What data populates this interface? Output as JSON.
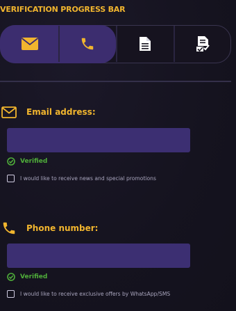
{
  "title": "VERIFICATION PROGRESS BAR",
  "progress": {
    "completed_steps": 2,
    "total_steps": 4,
    "steps": [
      {
        "icon": "envelope-icon",
        "state": "completed"
      },
      {
        "icon": "phone-icon",
        "state": "completed"
      },
      {
        "icon": "document-icon",
        "state": "pending"
      },
      {
        "icon": "document-check-icon",
        "state": "pending"
      }
    ]
  },
  "email": {
    "label": "Email address:",
    "icon": "envelope-icon",
    "value": "",
    "status": "Verified",
    "consent_label": "I would like to receive news and special promotions"
  },
  "phone": {
    "label": "Phone number:",
    "icon": "phone-icon",
    "value": "",
    "status": "Verified",
    "consent_label": "I would like to receive exclusive offers by WhatsApp/SMS"
  },
  "colors": {
    "accent": "#f1b52e",
    "fill": "#3c2d6f",
    "input": "#3c2f72",
    "verified": "#4fae3a",
    "background": "#15131f"
  }
}
